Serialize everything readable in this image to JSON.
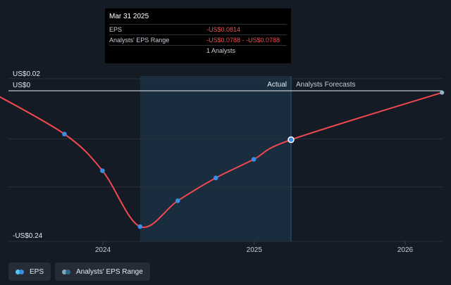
{
  "colors": {
    "eps_line": "#f0484f",
    "eps_marker": "#3a8ee6",
    "range_marker": "#5b8fa8",
    "forecast_shade": "#1b3447",
    "grid": "#2a323d"
  },
  "chart_data": {
    "type": "line",
    "x_ticks": [
      "2024",
      "2025",
      "2026"
    ],
    "y_labels": {
      "top": "US$0.02",
      "zero": "US$0",
      "bottom": "-US$0.24"
    },
    "ylim": [
      -0.24,
      0.02
    ],
    "region_labels": {
      "actual": "Actual",
      "forecast": "Analysts Forecasts"
    },
    "actual_start": "2024-03-31",
    "actual_end": "2025-03-31",
    "series": [
      {
        "name": "EPS",
        "points": [
          {
            "x": "2023-03-31",
            "y": 0.0
          },
          {
            "x": "2023-09-30",
            "y": -0.072
          },
          {
            "x": "2023-12-31",
            "y": -0.133
          },
          {
            "x": "2024-03-31",
            "y": -0.226
          },
          {
            "x": "2024-06-30",
            "y": -0.183
          },
          {
            "x": "2024-09-30",
            "y": -0.145
          },
          {
            "x": "2024-12-31",
            "y": -0.114
          },
          {
            "x": "2025-03-31",
            "y": -0.0814
          },
          {
            "x": "2026-03-31",
            "y": -0.003
          }
        ]
      }
    ]
  },
  "tooltip": {
    "date": "Mar 31 2025",
    "rows": [
      {
        "label": "EPS",
        "value": "-US$0.0814"
      },
      {
        "label": "Analysts' EPS Range",
        "value": "-US$0.0788 - -US$0.0788"
      },
      {
        "label": "",
        "value": "1 Analysts"
      }
    ]
  },
  "legend": [
    {
      "label": "EPS"
    },
    {
      "label": "Analysts' EPS Range"
    }
  ]
}
